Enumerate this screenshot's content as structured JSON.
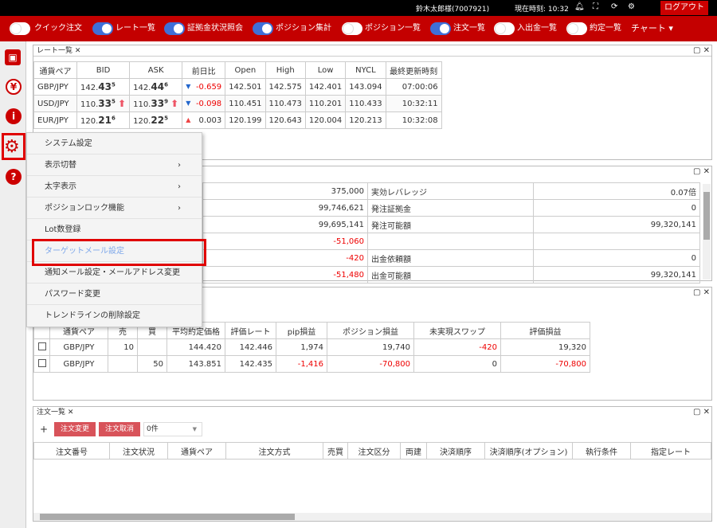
{
  "topbar": {
    "user": "鈴木太郎様(7007921)",
    "time_label": "現在時刻: 10:32",
    "logout": "ログアウト",
    "icons": {
      "bell": "bell-icon",
      "fullscreen": "fullscreen-icon",
      "refresh": "refresh-icon",
      "settings": "gear-icon"
    }
  },
  "nav": {
    "items": [
      {
        "label": "クイック注文",
        "on": false
      },
      {
        "label": "レート一覧",
        "on": true
      },
      {
        "label": "証拠金状況照会",
        "on": true
      },
      {
        "label": "ポジション集計",
        "on": true
      },
      {
        "label": "ポジション一覧",
        "on": false
      },
      {
        "label": "注文一覧",
        "on": true
      },
      {
        "label": "入出金一覧",
        "on": false
      },
      {
        "label": "約定一覧",
        "on": false
      }
    ],
    "chart": "チャート"
  },
  "sidebar": {
    "icons": [
      "save-icon",
      "yen-icon",
      "info-icon",
      "gear-icon",
      "help-icon"
    ]
  },
  "rates": {
    "title": "レート一覧",
    "headers": [
      "通貨ペア",
      "BID",
      "ASK",
      "前日比",
      "Open",
      "High",
      "Low",
      "NYCL",
      "最終更新時刻"
    ],
    "rows": [
      {
        "pair": "GBP/JPY",
        "bid_a": "142.",
        "bid_b": "43",
        "bid_c": "5",
        "ask_a": "142.",
        "ask_b": "44",
        "ask_c": "6",
        "arrow": "",
        "trend": "down",
        "change": "-0.659",
        "open": "142.501",
        "high": "142.575",
        "low": "142.401",
        "nycl": "143.094",
        "time": "07:00:06"
      },
      {
        "pair": "USD/JPY",
        "bid_a": "110.",
        "bid_b": "33",
        "bid_c": "5",
        "ask_a": "110.",
        "ask_b": "33",
        "ask_c": "9",
        "arrow": "up",
        "trend": "down",
        "change": "-0.098",
        "open": "110.451",
        "high": "110.473",
        "low": "110.201",
        "nycl": "110.433",
        "time": "10:32:11"
      },
      {
        "pair": "EUR/JPY",
        "bid_a": "120.",
        "bid_b": "21",
        "bid_c": "6",
        "ask_a": "120.",
        "ask_b": "22",
        "ask_c": "5",
        "arrow": "",
        "trend": "up",
        "change": "0.003",
        "open": "120.199",
        "high": "120.643",
        "low": "120.004",
        "nycl": "120.213",
        "time": "10:32:08"
      }
    ]
  },
  "account": {
    "rows": [
      {
        "v1": "375,000",
        "l2": "実効レバレッジ",
        "v2": "0.07倍"
      },
      {
        "v1": "99,746,621",
        "l2": "発注証拠金",
        "v2": "0"
      },
      {
        "v1": "99,695,141",
        "l2": "発注可能額",
        "v2": "99,320,141"
      },
      {
        "v1": "-51,060",
        "l2": "",
        "v2": ""
      },
      {
        "v1": "-420",
        "l2": "出金依頼額",
        "v2": "0"
      },
      {
        "v1": "-51,480",
        "l2": "出金可能額",
        "v2": "99,320,141"
      }
    ]
  },
  "positions": {
    "headers": [
      "",
      "通貨ペア",
      "売",
      "買",
      "平均約定価格",
      "評価レート",
      "pip損益",
      "ポジション損益",
      "未実現スワップ",
      "評価損益"
    ],
    "rows": [
      {
        "pair": "GBP/JPY",
        "sell": "10",
        "buy": "",
        "avg": "144.420",
        "rate": "142.446",
        "pip": "1,974",
        "pl": "19,740",
        "swap": "-420",
        "eval": "19,320"
      },
      {
        "pair": "GBP/JPY",
        "sell": "",
        "buy": "50",
        "avg": "143.851",
        "rate": "142.435",
        "pip": "-1,416",
        "pl": "-70,800",
        "swap": "0",
        "eval": "-70,800"
      }
    ]
  },
  "orders": {
    "title": "注文一覧",
    "add": "+",
    "modify": "注文変更",
    "cancel": "注文取消",
    "count": "0件",
    "headers": [
      "注文番号",
      "注文状況",
      "通貨ペア",
      "注文方式",
      "売買",
      "注文区分",
      "両建",
      "決済順序",
      "決済順序(オプション)",
      "執行条件",
      "指定レート"
    ]
  },
  "menu": {
    "items": [
      {
        "label": "システム設定",
        "arrow": ""
      },
      {
        "label": "表示切替",
        "arrow": "›"
      },
      {
        "label": "太字表示",
        "arrow": "›"
      },
      {
        "label": "ポジションロック機能",
        "arrow": "›"
      },
      {
        "label": "Lot数登録",
        "arrow": ""
      },
      {
        "label": "ターゲットメール設定",
        "arrow": ""
      },
      {
        "label": "通知メール設定・メールアドレス変更",
        "arrow": ""
      },
      {
        "label": "パスワード変更",
        "arrow": ""
      },
      {
        "label": "トレンドラインの削除設定",
        "arrow": ""
      }
    ]
  }
}
